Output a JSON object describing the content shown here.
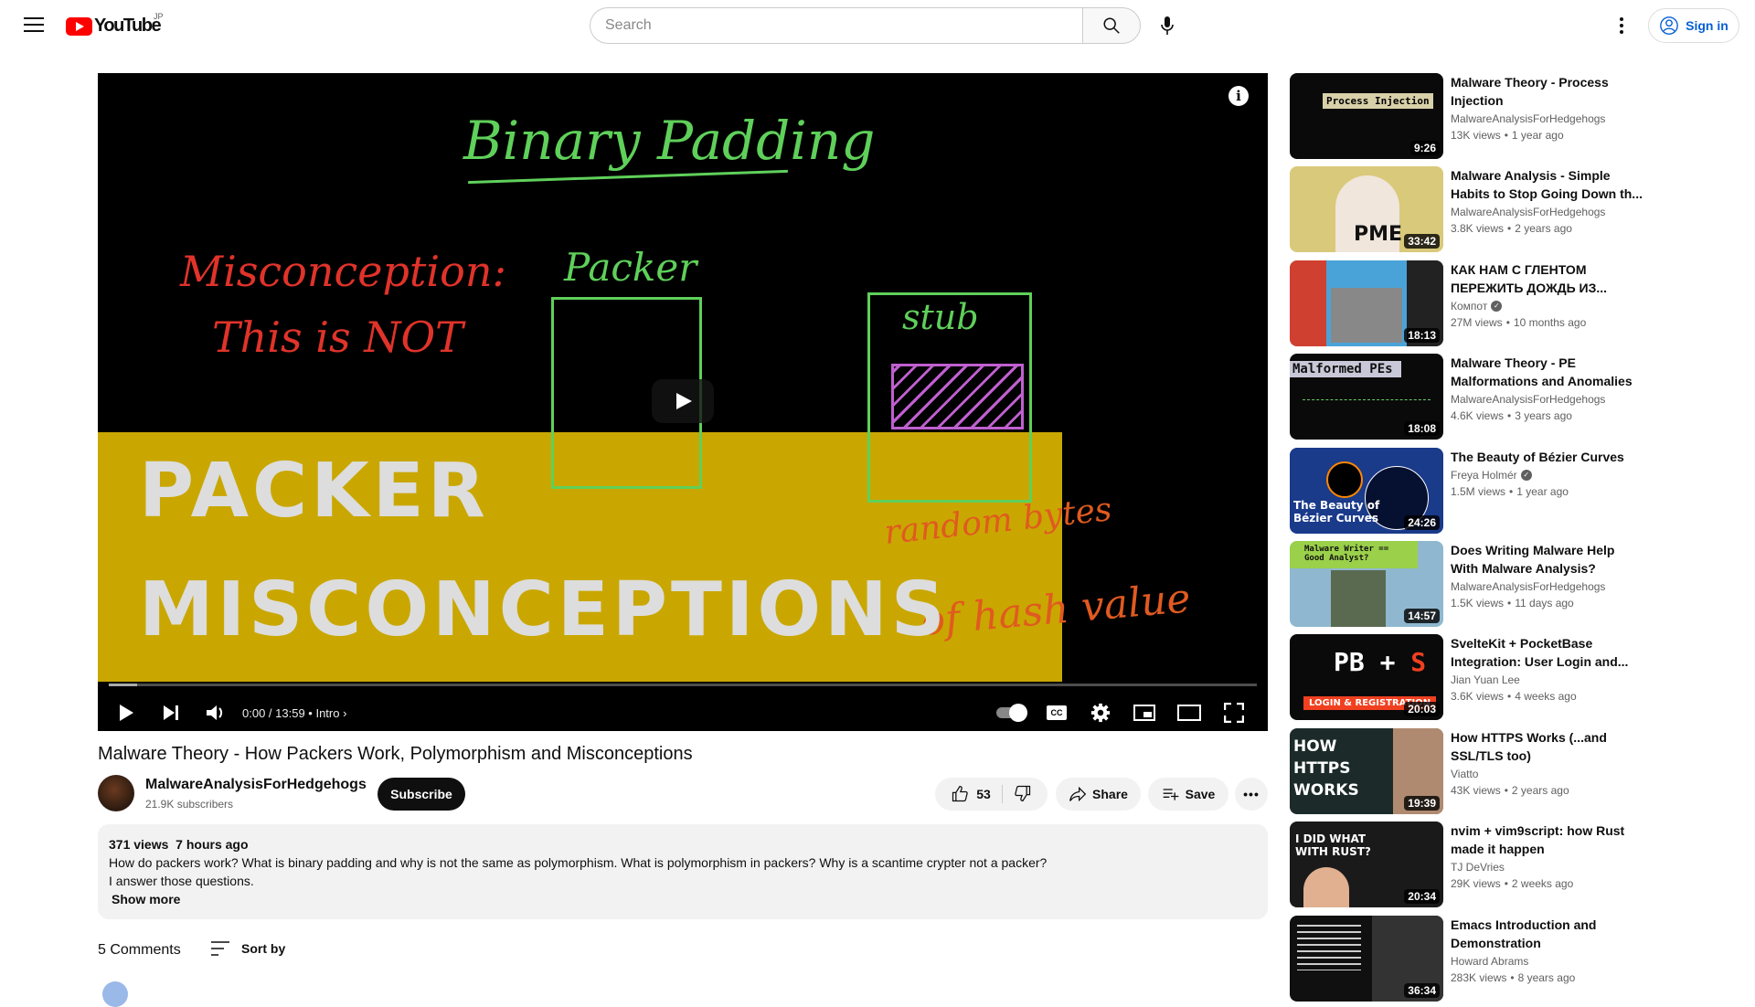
{
  "header": {
    "logo_text": "YouTube",
    "region": "JP",
    "search_placeholder": "Search",
    "sign_in": "Sign in"
  },
  "player": {
    "overlay_lines": {
      "binary_padding": "Binary Padding",
      "misconception": "Misconception:",
      "not": "This is NOT",
      "packer": "Packer",
      "stub": "stub",
      "random": "random bytes",
      "hash": "of hash value"
    },
    "big_text": [
      "PACKER",
      "MISCONCEPTIONS"
    ],
    "time": "0:00 / 13:59",
    "chapter": "Intro",
    "progress_fraction": 0.0,
    "autoplay": "on"
  },
  "video": {
    "title": "Malware Theory - How Packers Work, Polymorphism and Misconceptions",
    "channel": "MalwareAnalysisForHedgehogs",
    "subscribers": "21.9K subscribers",
    "subscribe": "Subscribe",
    "likes": "53",
    "share": "Share",
    "save": "Save",
    "views": "371 views",
    "age": "7 hours ago",
    "description": [
      "How do packers work? What is binary padding and why is not the same as polymorphism. What is polymorphism in packers? Why is a scantime crypter not a packer?",
      "I answer those questions."
    ],
    "show_more": "Show more",
    "comments": "5 Comments",
    "sort_by": "Sort by"
  },
  "recommendations": [
    {
      "title": "Malware Theory - Process Injection",
      "channel": "MalwareAnalysisForHedgehogs",
      "views": "13K views",
      "age": "1 year ago",
      "duration": "9:26",
      "thumb_text": "Process Injection",
      "verified": false,
      "bg": "#0a0a0a"
    },
    {
      "title": "Malware Analysis - Simple Habits to Stop Going Down th...",
      "channel": "MalwareAnalysisForHedgehogs",
      "views": "3.8K views",
      "age": "2 years ago",
      "duration": "33:42",
      "thumb_text": "PME",
      "verified": false,
      "bg": "#d9c97a"
    },
    {
      "title": "КАК НАМ С ГЛЕНТОМ ПЕРЕЖИТЬ ДОЖДЬ ИЗ...",
      "channel": "Компот",
      "views": "27M views",
      "age": "10 months ago",
      "duration": "18:13",
      "thumb_text": "",
      "verified": true,
      "bg": "#4aa3d8"
    },
    {
      "title": "Malware Theory - PE Malformations and Anomalies",
      "channel": "MalwareAnalysisForHedgehogs",
      "views": "4.6K views",
      "age": "3 years ago",
      "duration": "18:08",
      "thumb_text": "Malformed PEs",
      "verified": false,
      "bg": "#0a0a0a"
    },
    {
      "title": "The Beauty of Bézier Curves",
      "channel": "Freya Holmér",
      "views": "1.5M views",
      "age": "1 year ago",
      "duration": "24:26",
      "thumb_text": "The Beauty of Bézier Curves",
      "verified": true,
      "bg": "#1a3a8a"
    },
    {
      "title": "Does Writing Malware Help With Malware Analysis?",
      "channel": "MalwareAnalysisForHedgehogs",
      "views": "1.5K views",
      "age": "11 days ago",
      "duration": "14:57",
      "thumb_text": "Malware Writer == Good Analyst?",
      "verified": false,
      "bg": "#8fb8d0"
    },
    {
      "title": "SvelteKit + PocketBase Integration: User Login and...",
      "channel": "Jian Yuan Lee",
      "views": "3.6K views",
      "age": "4 weeks ago",
      "duration": "20:03",
      "thumb_text": "LOGIN & REGISTRATION",
      "verified": false,
      "bg": "#0a0a0a"
    },
    {
      "title": "How HTTPS Works (...and SSL/TLS too)",
      "channel": "Viatto",
      "views": "43K views",
      "age": "2 years ago",
      "duration": "19:39",
      "thumb_text": "HOW HTTPS WORKS",
      "verified": false,
      "bg": "#1c2a2a"
    },
    {
      "title": "nvim + vim9script: how Rust made it happen",
      "channel": "TJ DeVries",
      "views": "29K views",
      "age": "2 weeks ago",
      "duration": "20:34",
      "thumb_text": "I DID WHAT WITH RUST?",
      "verified": false,
      "bg": "#1a1a1a"
    },
    {
      "title": "Emacs Introduction and Demonstration",
      "channel": "Howard Abrams",
      "views": "283K views",
      "age": "8 years ago",
      "duration": "36:34",
      "thumb_text": "",
      "verified": false,
      "bg": "#101010"
    }
  ]
}
